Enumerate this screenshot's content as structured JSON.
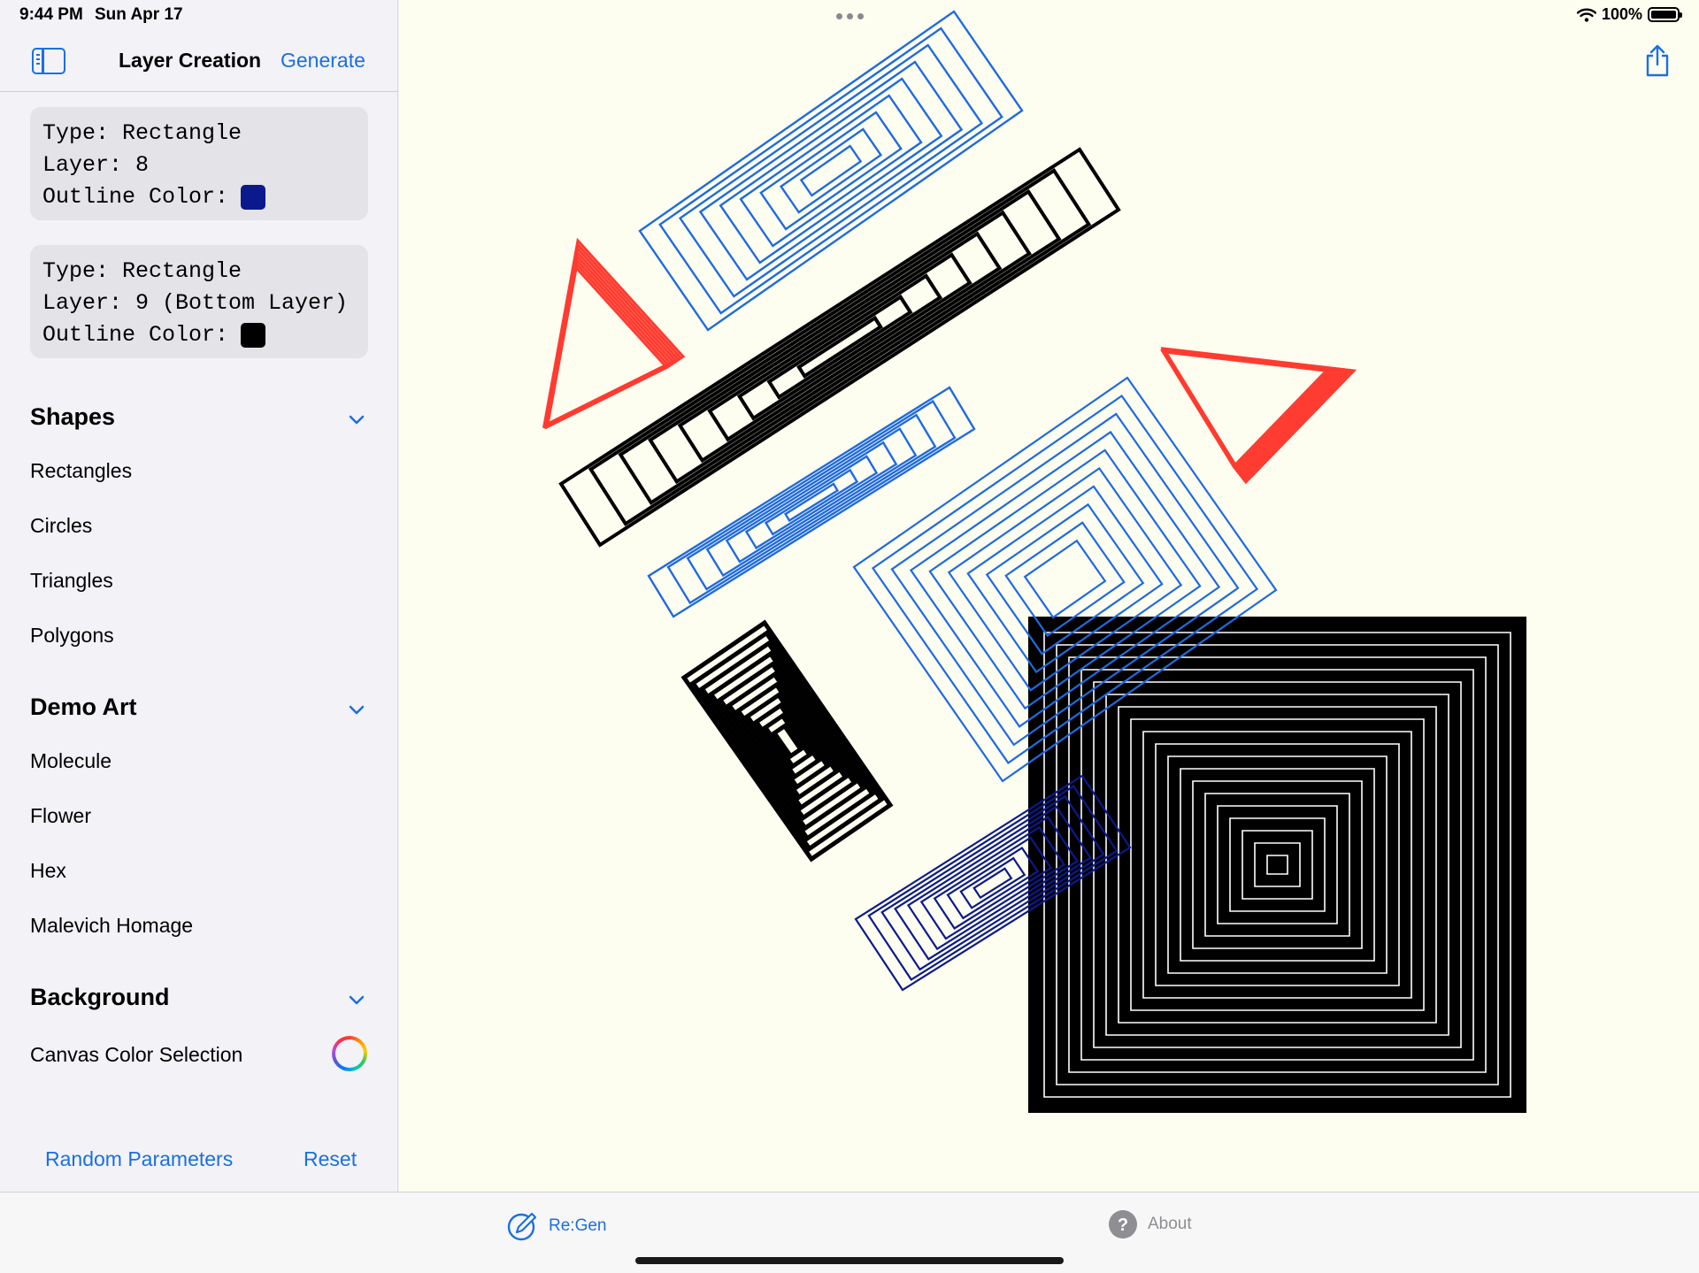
{
  "status": {
    "time": "9:44 PM",
    "date": "Sun Apr 17",
    "battery": "100%"
  },
  "sidebar": {
    "title": "Layer Creation",
    "generate": "Generate",
    "layers": [
      {
        "type_label": "Type:",
        "type": "Rectangle",
        "layer_label": "Layer:",
        "layer": "8",
        "color_label": "Outline Color:",
        "color": "#0a1a8c"
      },
      {
        "type_label": "Type:",
        "type": "Rectangle",
        "layer_label": "Layer:",
        "layer": "9 (Bottom Layer)",
        "color_label": "Outline Color:",
        "color": "#000000"
      }
    ],
    "sections": {
      "shapes": {
        "title": "Shapes",
        "items": [
          "Rectangles",
          "Circles",
          "Triangles",
          "Polygons"
        ]
      },
      "demo": {
        "title": "Demo Art",
        "items": [
          "Molecule",
          "Flower",
          "Hex",
          "Malevich Homage"
        ]
      },
      "background": {
        "title": "Background",
        "items": [
          "Canvas Color Selection"
        ]
      }
    },
    "random": "Random Parameters",
    "reset": "Reset"
  },
  "tabs": {
    "regen": "Re:Gen",
    "about": "About"
  },
  "colors": {
    "accent": "#1c6fe0",
    "blue": "#1f6ae0",
    "navy": "#0a1a8c",
    "red": "#ff3b30",
    "black": "#000000",
    "canvas": "#fdfdf0"
  }
}
